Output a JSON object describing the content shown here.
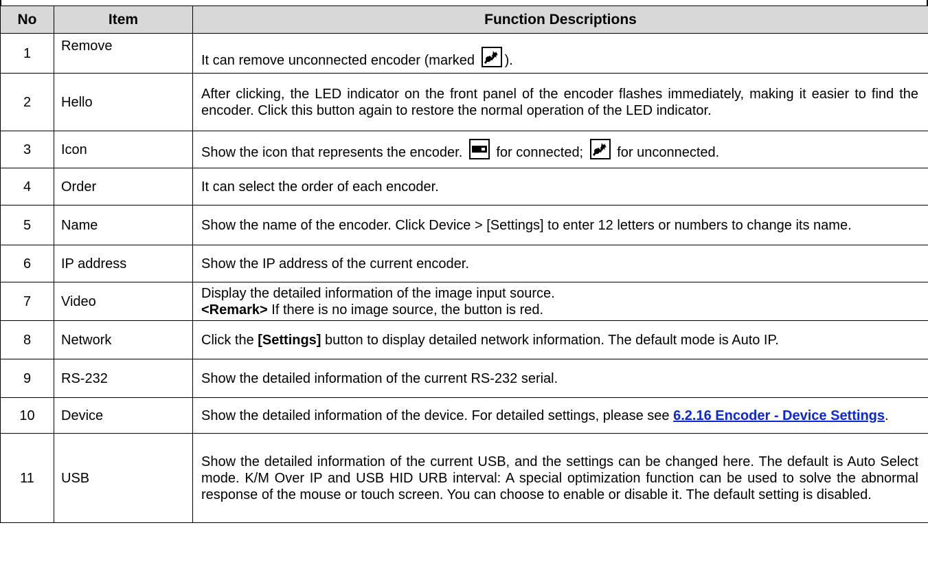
{
  "table": {
    "headers": {
      "no": "No",
      "item": "Item",
      "desc": "Function Descriptions"
    },
    "rows": [
      {
        "no": "1",
        "item": "Remove",
        "desc_a": "It can remove unconnected encoder (marked ",
        "desc_b": ")."
      },
      {
        "no": "2",
        "item": "Hello",
        "desc": "After clicking, the LED indicator on the front panel of the encoder flashes immediately, making it easier to find the encoder. Click this button again to restore the normal operation of the LED indicator."
      },
      {
        "no": "3",
        "item": "Icon",
        "desc_a": "Show the icon that represents the encoder. ",
        "desc_b": " for connected; ",
        "desc_c": " for unconnected."
      },
      {
        "no": "4",
        "item": "Order",
        "desc": "It can select the order of each encoder."
      },
      {
        "no": "5",
        "item": "Name",
        "desc": "Show the name of the encoder. Click Device > [Settings] to enter 12 letters or numbers to change its name."
      },
      {
        "no": "6",
        "item": "IP address",
        "desc": "Show the IP address of the current encoder."
      },
      {
        "no": "7",
        "item": "Video",
        "desc_a": "Display the detailed information of the image input source.",
        "remark_label": "<Remark>",
        "remark_text": " If there is no image source, the button is red."
      },
      {
        "no": "8",
        "item": "Network",
        "desc_a": "Click the ",
        "bold": "[Settings]",
        "desc_b": " button to display detailed network information. The default mode is Auto IP."
      },
      {
        "no": "9",
        "item": "RS-232",
        "desc": "Show the detailed information of the current RS-232 serial."
      },
      {
        "no": "10",
        "item": "Device",
        "desc_a": "Show the detailed information of the device. For detailed settings, please see ",
        "link": "6.2.16 Encoder - Device Settings",
        "desc_b": "."
      },
      {
        "no": "11",
        "item": "USB",
        "desc": "Show the detailed information of the current USB, and the settings can be changed here. The default is Auto Select mode. K/M Over IP and USB HID URB interval: A special optimization function can be used to solve the abnormal response of the mouse or touch screen. You can choose to enable or disable it. The default setting is disabled."
      }
    ]
  }
}
